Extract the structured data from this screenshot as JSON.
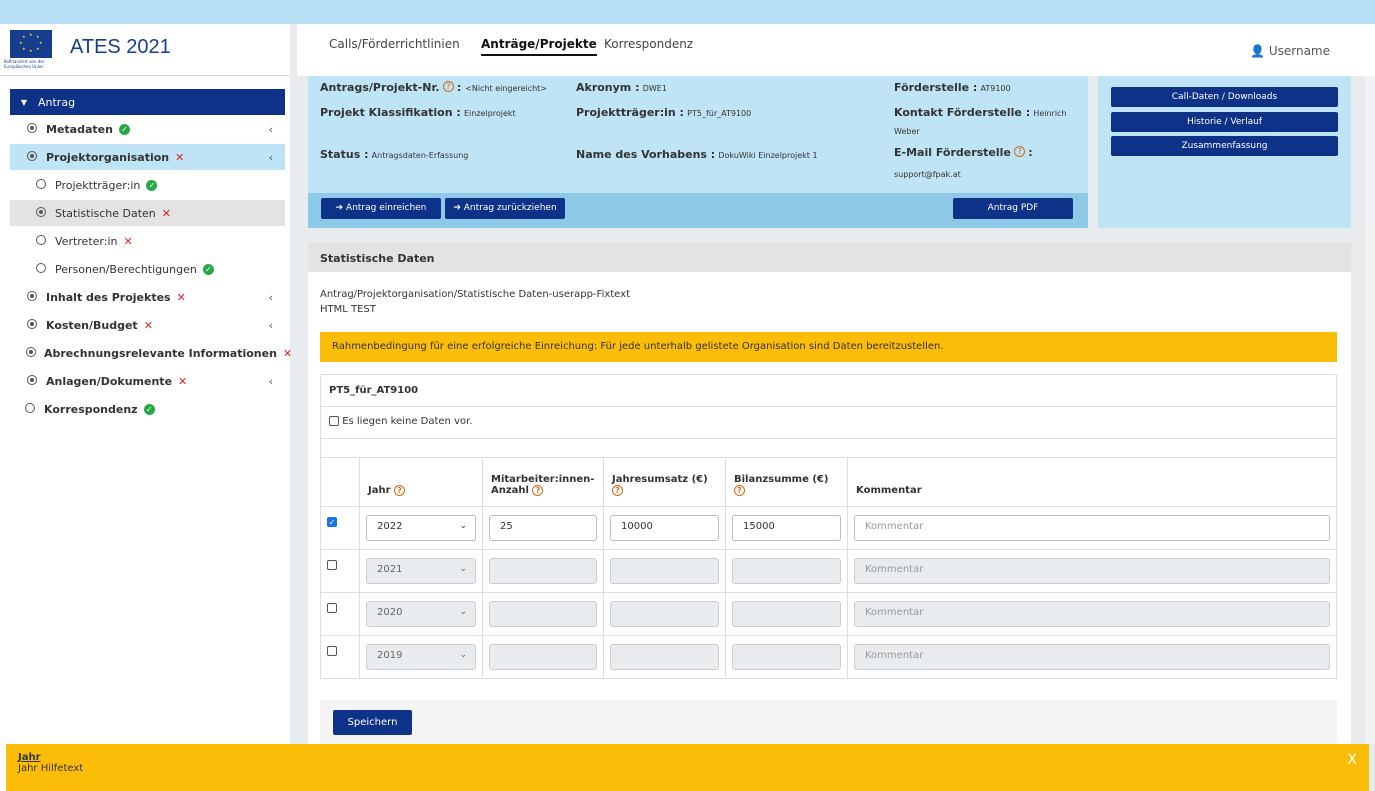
{
  "app": {
    "title": "ATES 2021",
    "eu_caption": "Kofinanziert von der Europäischen Union",
    "username": "Username"
  },
  "tabs": [
    {
      "label": "Calls/Förderrichtlinien"
    },
    {
      "label": "Anträge/Projekte"
    },
    {
      "label": "Korrespondenz"
    }
  ],
  "sidebar": {
    "items": [
      {
        "label": "Antrag"
      },
      {
        "label": "Metadaten"
      },
      {
        "label": "Projektorganisation"
      },
      {
        "label": "Projektträger:in"
      },
      {
        "label": "Statistische Daten"
      },
      {
        "label": "Vertreter:in"
      },
      {
        "label": "Personen/Berechtigungen"
      },
      {
        "label": "Inhalt des Projektes"
      },
      {
        "label": "Kosten/Budget"
      },
      {
        "label": "Abrechnungsrelevante Informationen"
      },
      {
        "label": "Anlagen/Dokumente"
      },
      {
        "label": "Korrespondenz"
      }
    ]
  },
  "info": {
    "nr_label": "Antrags/Projekt-Nr.",
    "nr_value": "<Nicht eingereicht>",
    "akronym_label": "Akronym :",
    "akronym_value": "DWE1",
    "foerderstelle_label": "Förderstelle :",
    "foerderstelle_value": "AT9100",
    "klass_label": "Projekt Klassifikation :",
    "klass_value": "Einzelprojekt",
    "traeger_label": "Projektträger:in :",
    "traeger_value": "PT5_für_AT9100",
    "kontakt_label": "Kontakt Förderstelle :",
    "kontakt_value_1": "Heinrich",
    "kontakt_value_2": "Weber",
    "status_label": "Status :",
    "status_value": "Antragsdaten-Erfassung",
    "vorhaben_label": "Name des Vorhabens :",
    "vorhaben_value": "DokuWiki Einzelprojekt 1",
    "email_label": "E-Mail Förderstelle",
    "email_value": "support@fpak.at"
  },
  "actions": {
    "einreichen": "Antrag einreichen",
    "zurueckziehen": "Antrag zurückziehen",
    "pdf": "Antrag PDF",
    "call_daten": "Call-Daten / Downloads",
    "historie": "Historie / Verlauf",
    "zusammenfassung": "Zusammenfassung"
  },
  "section": {
    "title": "Statistische Daten",
    "path_text": "Antrag/Projektorganisation/Statistische Daten-userapp-Fixtext",
    "html_test": "HTML TEST",
    "alert": "Rahmenbedingung für eine erfolgreiche Einreichung: Für jede unterhalb gelistete Organisation sind Daten bereitzustellen.",
    "org_name": "PT5_für_AT9100",
    "no_data_label": "Es liegen keine Daten vor."
  },
  "table": {
    "headers": {
      "jahr": "Jahr",
      "mitarbeiter_1": "Mitarbeiter:innen-",
      "mitarbeiter_2": "Anzahl",
      "umsatz": "Jahresumsatz (€)",
      "bilanz": "Bilanzsumme (€)",
      "kommentar": "Kommentar"
    },
    "placeholder": "Kommentar",
    "rows": [
      {
        "checked": true,
        "year": "2022",
        "employees": "25",
        "revenue": "10000",
        "balance": "15000"
      },
      {
        "checked": false,
        "year": "2021",
        "employees": "",
        "revenue": "",
        "balance": ""
      },
      {
        "checked": false,
        "year": "2020",
        "employees": "",
        "revenue": "",
        "balance": ""
      },
      {
        "checked": false,
        "year": "2019",
        "employees": "",
        "revenue": "",
        "balance": ""
      }
    ]
  },
  "save_label": "Speichern",
  "help": {
    "title": "Jahr",
    "text": "Jahr Hilfetext",
    "close": "X"
  }
}
